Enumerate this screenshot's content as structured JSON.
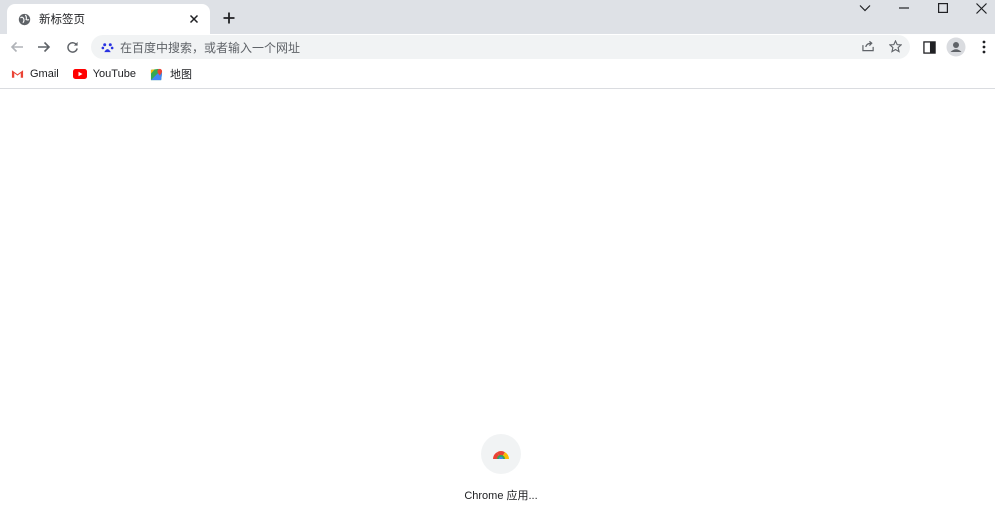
{
  "tab": {
    "title": "新标签页",
    "favicon": "globe-icon"
  },
  "window_controls": [
    "chevron-down-icon",
    "minimize-icon",
    "maximize-icon",
    "close-icon"
  ],
  "omnibox": {
    "placeholder": "在百度中搜索，或者输入一个网址",
    "engine_icon": "baidu-paw-icon"
  },
  "bookmarks": [
    {
      "label": "Gmail",
      "icon": "gmail-icon"
    },
    {
      "label": "YouTube",
      "icon": "youtube-icon"
    },
    {
      "label": "地图",
      "icon": "maps-icon"
    }
  ],
  "shortcuts": [
    {
      "label": "Chrome 应用...",
      "icon": "chrome-apps-icon"
    }
  ],
  "colors": {
    "tabstrip": "#dee1e6",
    "omnibox": "#f1f3f4",
    "baidu": "#2932e1"
  }
}
